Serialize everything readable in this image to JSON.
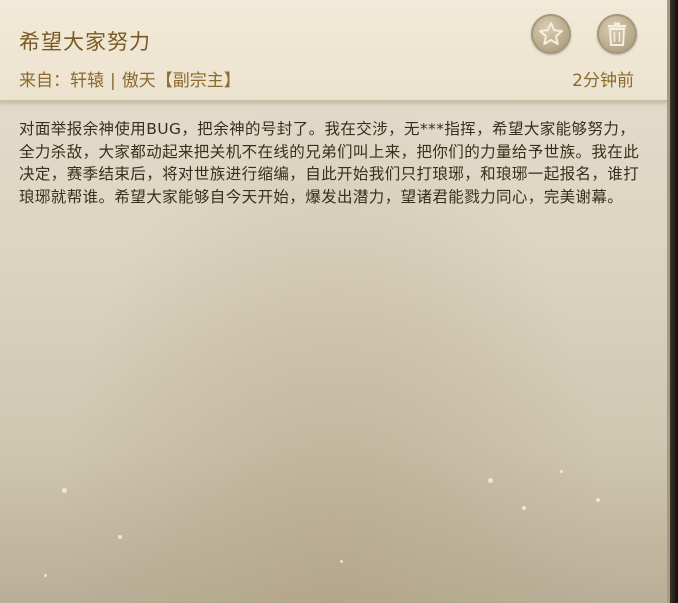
{
  "message": {
    "title": "希望大家努力",
    "from_label": "来自：",
    "sender_name": "轩辕",
    "separator": "|",
    "sender_title": "傲天【副宗主】",
    "time": "2分钟前",
    "body": "对面举报余神使用BUG，把余神的号封了。我在交涉，无***指挥，希望大家能够努力，全力杀敌，大家都动起来把关机不在线的兄弟们叫上来，把你们的力量给予世族。我在此决定，赛季结束后，将对世族进行缩编，自此开始我们只打琅琊，和琅琊一起报名，谁打琅琊就帮谁。希望大家能够自今天开始，爆发出潜力，望诸君能戮力同心，完美谢幕。"
  },
  "icons": {
    "favorite": "star-icon",
    "delete": "trash-icon"
  },
  "colors": {
    "title": "#7a5a24",
    "meta": "#8c6a30",
    "body_text": "#3a2e1c",
    "header_bg": "#efe7d4",
    "icon_bg": "#b7a98a"
  }
}
